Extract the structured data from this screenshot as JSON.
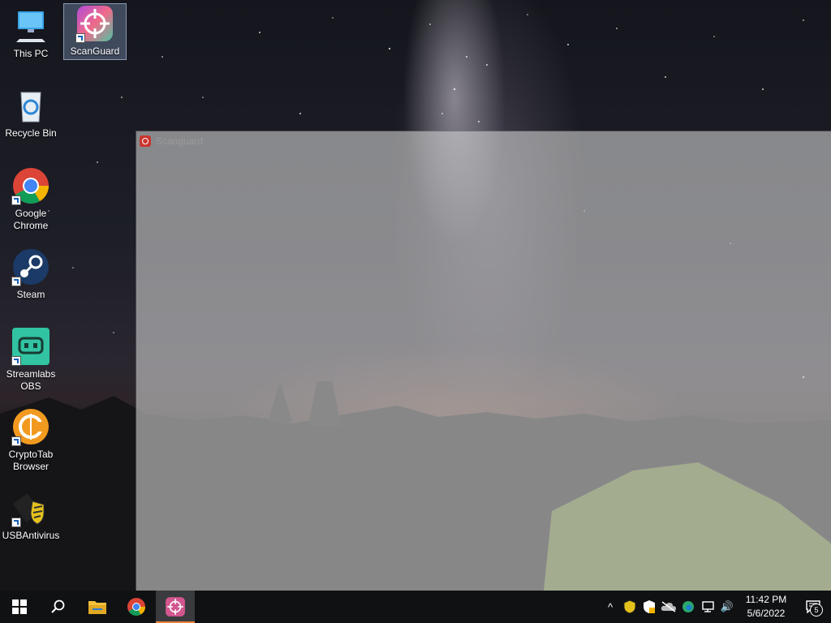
{
  "desktop": {
    "icons": [
      {
        "label": "This PC"
      },
      {
        "label": "ScanGuard"
      },
      {
        "label": "Recycle Bin"
      },
      {
        "label": "Google Chrome"
      },
      {
        "label": "Steam"
      },
      {
        "label": "Streamlabs OBS"
      },
      {
        "label": "CryptoTab Browser"
      },
      {
        "label": "USBAntivirus"
      }
    ]
  },
  "window": {
    "title": "Scanguard",
    "minimize_glyph": "–"
  },
  "taskbar": {
    "apps": [
      {
        "icon": "windows-start-icon"
      },
      {
        "icon": "search-icon"
      },
      {
        "icon": "file-explorer-icon"
      },
      {
        "icon": "chrome-icon"
      },
      {
        "icon": "scanguard-icon"
      }
    ],
    "tray": {
      "chevron": "^",
      "volume": "🔊",
      "time": "11:42 PM",
      "date": "5/6/2022",
      "notification_count": "5"
    }
  },
  "colors": {
    "taskbar_bg": "#101113",
    "active_accent": "#e8833a",
    "window_overlay": "#cdcdcd"
  }
}
